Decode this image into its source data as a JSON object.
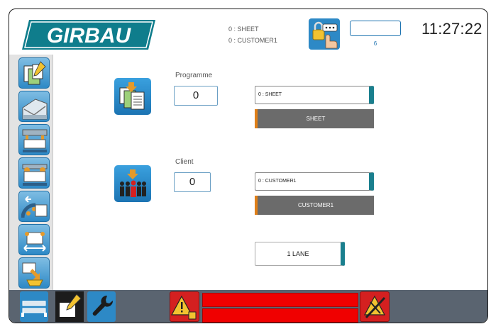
{
  "header": {
    "brand": "GIRBAU",
    "program_info": "0 : SHEET",
    "client_info": "0 : CUSTOMER1",
    "counter_value": "6",
    "clock": "11:27:22"
  },
  "program": {
    "label": "Programme",
    "number": "0",
    "select_value": "0 : SHEET",
    "name_button": "SHEET"
  },
  "client": {
    "label": "Client",
    "number": "0",
    "select_value": "0 : CUSTOMER1",
    "name_button": "CUSTOMER1"
  },
  "lane_button": "1 LANE",
  "sidebar": {
    "items": [
      {
        "icon": "programs-icon"
      },
      {
        "icon": "feeder-icon"
      },
      {
        "icon": "clamps-icon"
      },
      {
        "icon": "spreading-icon"
      },
      {
        "icon": "transfer-icon"
      },
      {
        "icon": "stretch-icon"
      },
      {
        "icon": "output-icon"
      }
    ]
  },
  "colors": {
    "brand": "#0f7d8c",
    "accent_blue": "#2d89c6",
    "teal_marker": "#1a7f8e",
    "orange_marker": "#e07f17",
    "alarm_red": "#f00000",
    "bottom_bar": "#5a6470"
  }
}
